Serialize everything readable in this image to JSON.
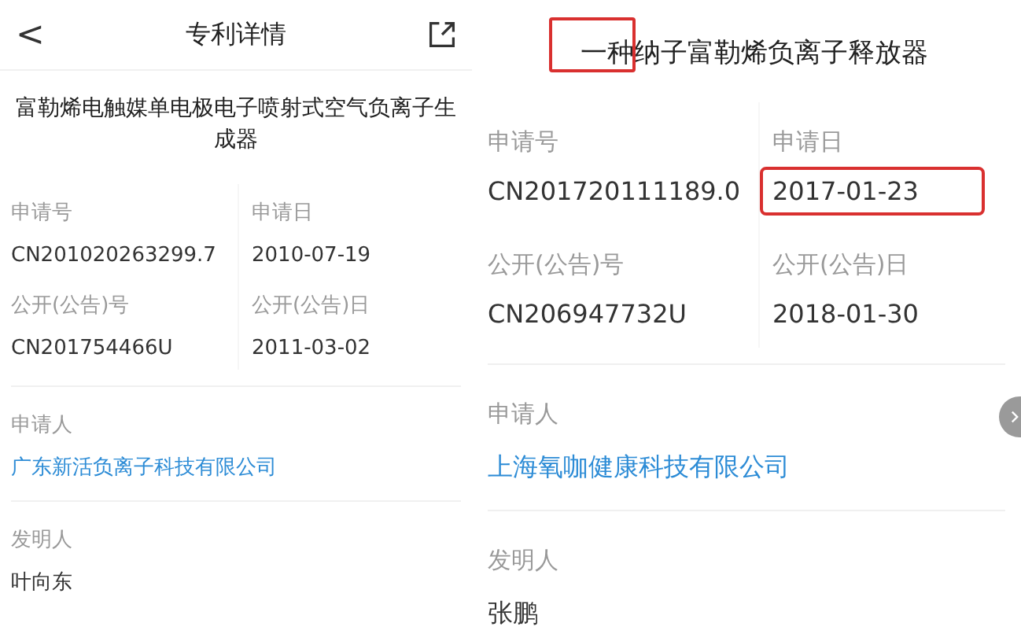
{
  "left_screen": {
    "header": {
      "back": "<",
      "title": "专利详情"
    },
    "patent_title": "富勒烯电触媒单电极电子喷射式空气负离子生成器",
    "fields": [
      {
        "label": "申请号",
        "value": "CN201020263299.7",
        "highlighted": false
      },
      {
        "label": "申请日",
        "value": "2010-07-19",
        "highlighted": false
      },
      {
        "label": "公开(公告)号",
        "value": "CN201754466U",
        "highlighted": false
      },
      {
        "label": "公开(公告)日",
        "value": "2011-03-02",
        "highlighted": false
      }
    ],
    "sections": [
      {
        "label": "申请人",
        "value": "广东新活负离子科技有限公司",
        "kind": "link"
      },
      {
        "label": "发明人",
        "value": "叶向东",
        "kind": "text"
      }
    ]
  },
  "right_screen": {
    "patent_title": "一种纳子富勒烯负离子释放器",
    "title_highlighted": true,
    "fields": [
      {
        "label": "申请号",
        "value": "CN201720111189.0",
        "highlighted": false
      },
      {
        "label": "申请日",
        "value": "2017-01-23",
        "highlighted": true
      },
      {
        "label": "公开(公告)号",
        "value": "CN206947732U",
        "highlighted": false
      },
      {
        "label": "公开(公告)日",
        "value": "2018-01-30",
        "highlighted": false
      }
    ],
    "sections": [
      {
        "label": "申请人",
        "value": "上海氧咖健康科技有限公司",
        "kind": "link",
        "chevron": true
      },
      {
        "label": "发明人",
        "value": "张鹏",
        "kind": "text"
      }
    ]
  }
}
